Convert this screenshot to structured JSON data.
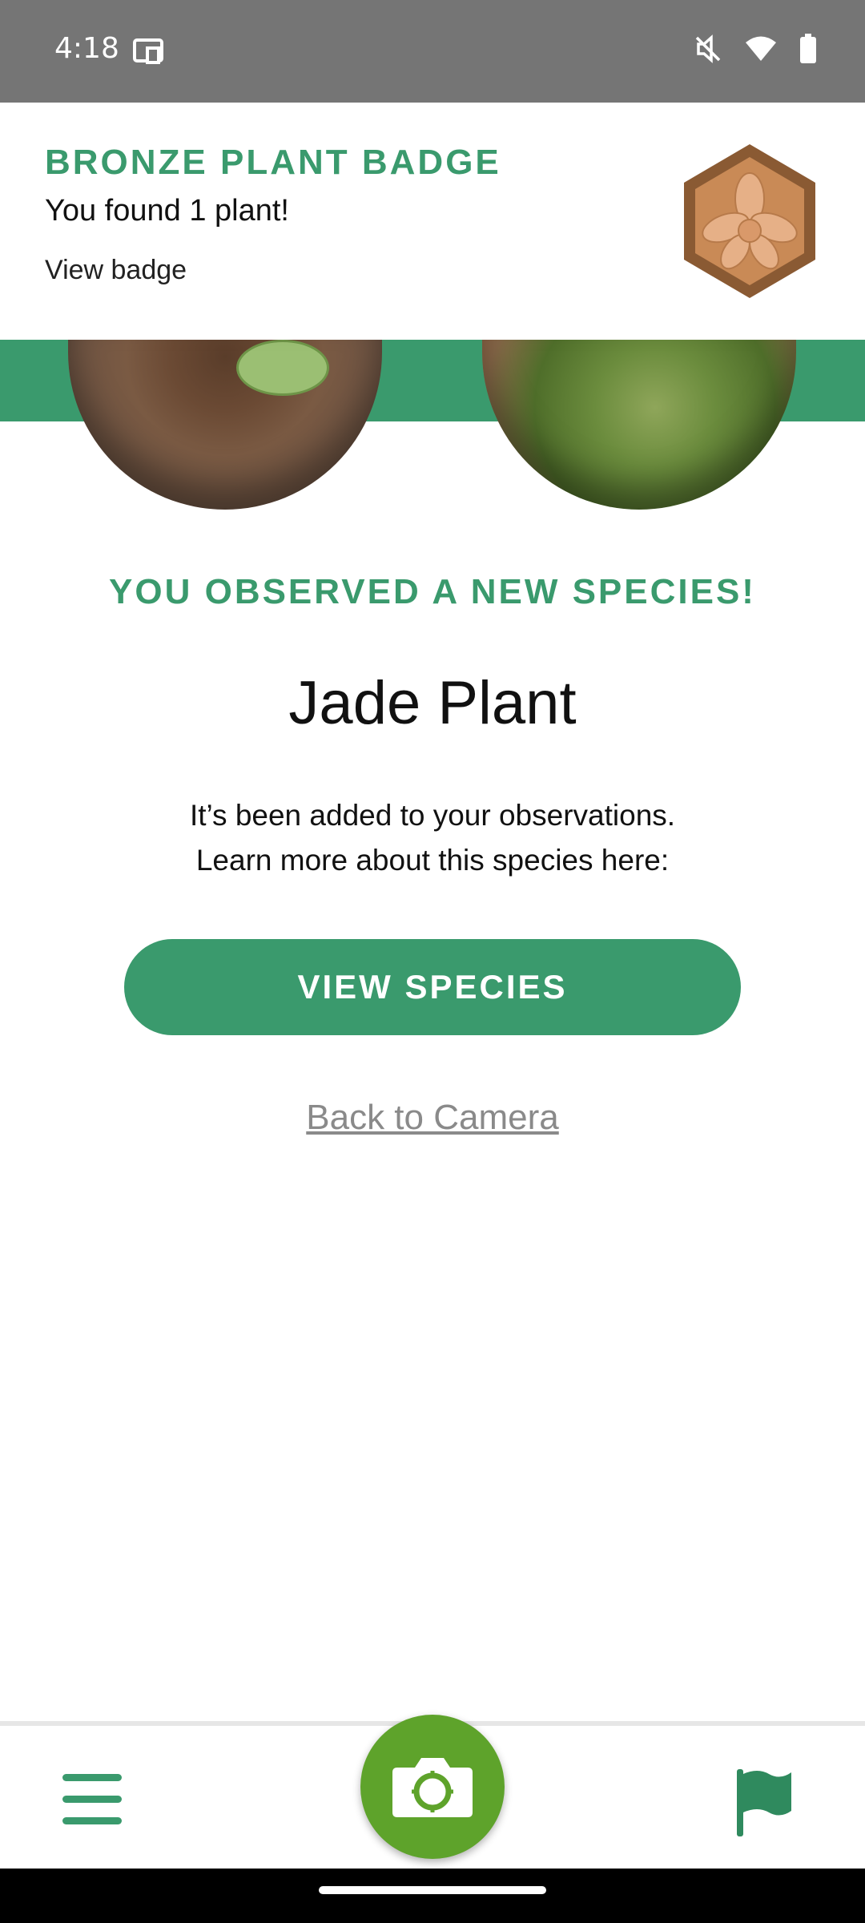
{
  "status_bar": {
    "time": "4:18",
    "icons": [
      "cast-icon",
      "mute-icon",
      "wifi-icon",
      "battery-icon"
    ]
  },
  "badge": {
    "title": "BRONZE PLANT BADGE",
    "subtitle": "You found 1 plant!",
    "link": "View badge",
    "icon": "bronze-orchid-badge-icon",
    "colors": {
      "outer": "#8a5a33",
      "inner": "#c98a56",
      "flower": "#e6b087"
    }
  },
  "main": {
    "headline": "YOU OBSERVED A NEW SPECIES!",
    "species_name": "Jade Plant",
    "description_line1": "It’s been added to your observations.",
    "description_line2": "Learn more about this species here:",
    "view_species_label": "VIEW SPECIES",
    "back_link": "Back to Camera"
  },
  "nav": {
    "menu_icon": "hamburger-menu-icon",
    "camera_icon": "camera-icon",
    "flag_icon": "flag-icon"
  },
  "colors": {
    "accent": "#3a9a6d",
    "camera": "#5ea32b",
    "status_bar": "#757575"
  }
}
